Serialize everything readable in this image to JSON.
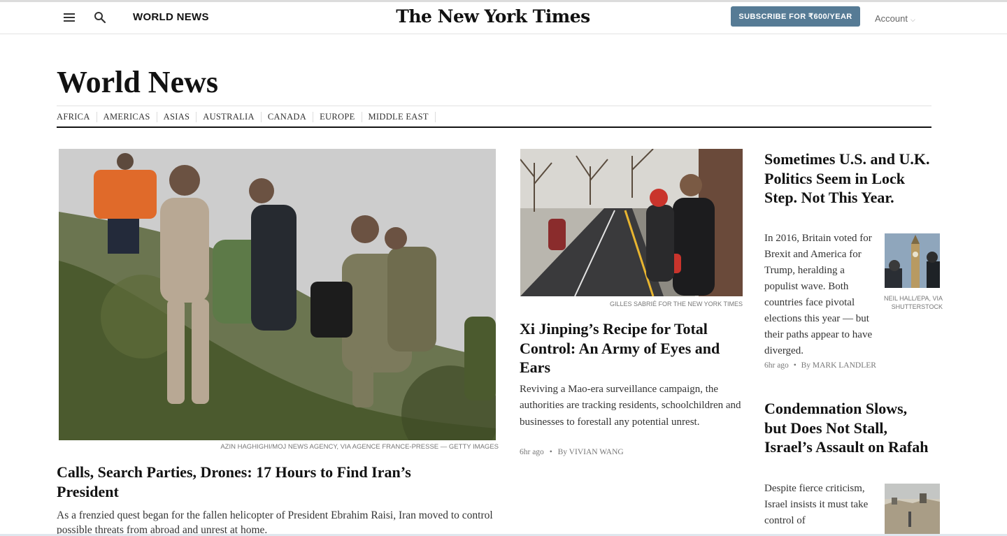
{
  "header": {
    "menu_icon": "hamburger-menu-icon",
    "search_icon": "search-icon",
    "section_label": "WORLD NEWS",
    "logo_text": "The New York Times",
    "subscribe_label": "SUBSCRIBE FOR ₹600/YEAR",
    "account_label": "Account",
    "accent_color": "#567b95"
  },
  "page": {
    "title": "World News",
    "subnav": [
      "AFRICA",
      "AMERICAS",
      "ASIAS",
      "AUSTRALIA",
      "CANADA",
      "EUROPE",
      "MIDDLE EAST"
    ]
  },
  "lead_story": {
    "image_credit": "AZIN HAGHIGHI/MOJ NEWS AGENCY, VIA AGENCE FRANCE-PRESSE — GETTY IMAGES",
    "headline": "Calls, Search Parties, Drones: 17 Hours to Find Iran’s President",
    "summary": "As a frenzied quest began for the fallen helicopter of President Ebrahim Raisi, Iran moved to control possible threats from abroad and unrest at home."
  },
  "middle_story": {
    "image_credit": "GILLES SABRIÉ FOR THE NEW YORK TIMES",
    "headline": "Xi Jinping’s Recipe for Total Control: An Army of Eyes and Ears",
    "summary": "Reviving a Mao-era surveillance campaign, the authorities are tracking residents, schoolchildren and businesses to forestall any potential unrest.",
    "time": "6hr ago",
    "separator": "•",
    "byline": "By VIVIAN WANG"
  },
  "right_stories": [
    {
      "headline": "Sometimes U.S. and U.K. Politics Seem in Lock Step. Not This Year.",
      "summary": "In 2016, Britain voted for Brexit and America for Trump, heralding a populist wave. Both countries face pivotal elections this year — but their paths appear to have diverged.",
      "image_credit": "NEIL HALL/EPA, VIA SHUTTERSTOCK",
      "time": "6hr ago",
      "separator": "•",
      "byline": "By MARK LANDLER"
    },
    {
      "headline": "Condemnation Slows, but Does Not Stall, Israel’s Assault on Rafah",
      "summary": "Despite fierce criticism, Israel insists it must take control of"
    }
  ]
}
